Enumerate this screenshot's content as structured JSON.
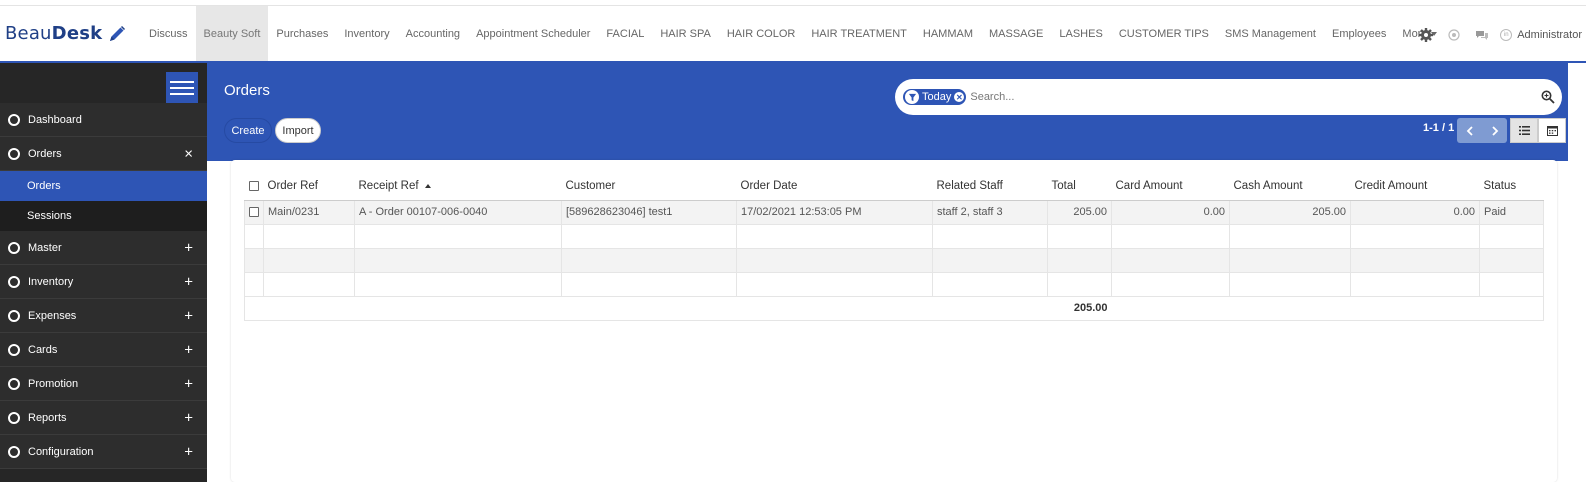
{
  "app": {
    "logo_light": "Beau",
    "logo_bold": "Desk"
  },
  "menu": [
    {
      "label": "Discuss",
      "active": false
    },
    {
      "label": "Beauty Soft",
      "active": true
    },
    {
      "label": "Purchases",
      "active": false
    },
    {
      "label": "Inventory",
      "active": false
    },
    {
      "label": "Accounting",
      "active": false
    },
    {
      "label": "Appointment Scheduler",
      "active": false
    },
    {
      "label": "FACIAL",
      "active": false
    },
    {
      "label": "HAIR SPA",
      "active": false
    },
    {
      "label": "HAIR COLOR",
      "active": false
    },
    {
      "label": "HAIR TREATMENT",
      "active": false
    },
    {
      "label": "HAMMAM",
      "active": false
    },
    {
      "label": "MASSAGE",
      "active": false
    },
    {
      "label": "LASHES",
      "active": false
    },
    {
      "label": "CUSTOMER TIPS",
      "active": false
    },
    {
      "label": "SMS Management",
      "active": false
    },
    {
      "label": "Employees",
      "active": false
    }
  ],
  "more_label": "More",
  "user": {
    "name": "Administrator"
  },
  "sidebar": {
    "items": [
      {
        "label": "Dashboard",
        "sign": ""
      },
      {
        "label": "Orders",
        "sign": "×"
      },
      {
        "label": "Master",
        "sign": "+"
      },
      {
        "label": "Inventory",
        "sign": "+"
      },
      {
        "label": "Expenses",
        "sign": "+"
      },
      {
        "label": "Cards",
        "sign": "+"
      },
      {
        "label": "Promotion",
        "sign": "+"
      },
      {
        "label": "Reports",
        "sign": "+"
      },
      {
        "label": "Configuration",
        "sign": "+"
      }
    ],
    "subitems": [
      {
        "label": "Orders",
        "active": true
      },
      {
        "label": "Sessions",
        "active": false
      }
    ]
  },
  "page": {
    "title": "Orders",
    "create_label": "Create",
    "import_label": "Import",
    "pager": "1-1 / 1"
  },
  "search": {
    "facet": "Today",
    "placeholder": "Search..."
  },
  "table": {
    "columns": [
      "Order Ref",
      "Receipt Ref",
      "Customer",
      "Order Date",
      "Related Staff",
      "Total",
      "Card Amount",
      "Cash Amount",
      "Credit Amount",
      "Status"
    ],
    "rows": [
      [
        "Main/0231",
        "A - Order 00107-006-0040",
        "[589628623046] test1",
        "17/02/2021 12:53:05 PM",
        "staff 2, staff 3",
        "205.00",
        "0.00",
        "205.00",
        "0.00",
        "Paid"
      ]
    ],
    "footer_total": "205.00"
  },
  "colors": {
    "primary": "#2e55b5",
    "sidebar_bg": "#262626"
  }
}
